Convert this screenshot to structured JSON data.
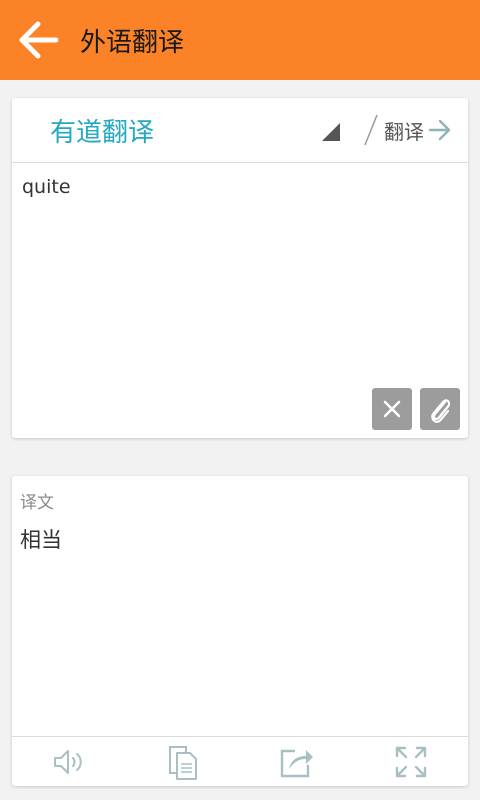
{
  "app_bar": {
    "title": "外语翻译",
    "back_icon": "arrow-left-icon",
    "background": "#fb8226"
  },
  "input_panel": {
    "engine_name": "有道翻译",
    "engine_color": "#22a8c3",
    "translate_label": "翻译",
    "source_text": "quite",
    "clear_icon": "close-icon",
    "attach_icon": "paperclip-icon"
  },
  "result_panel": {
    "label": "译文",
    "text": "相当",
    "actions": [
      {
        "name": "speaker-icon"
      },
      {
        "name": "copy-icon"
      },
      {
        "name": "share-icon"
      },
      {
        "name": "fullscreen-icon"
      }
    ]
  }
}
